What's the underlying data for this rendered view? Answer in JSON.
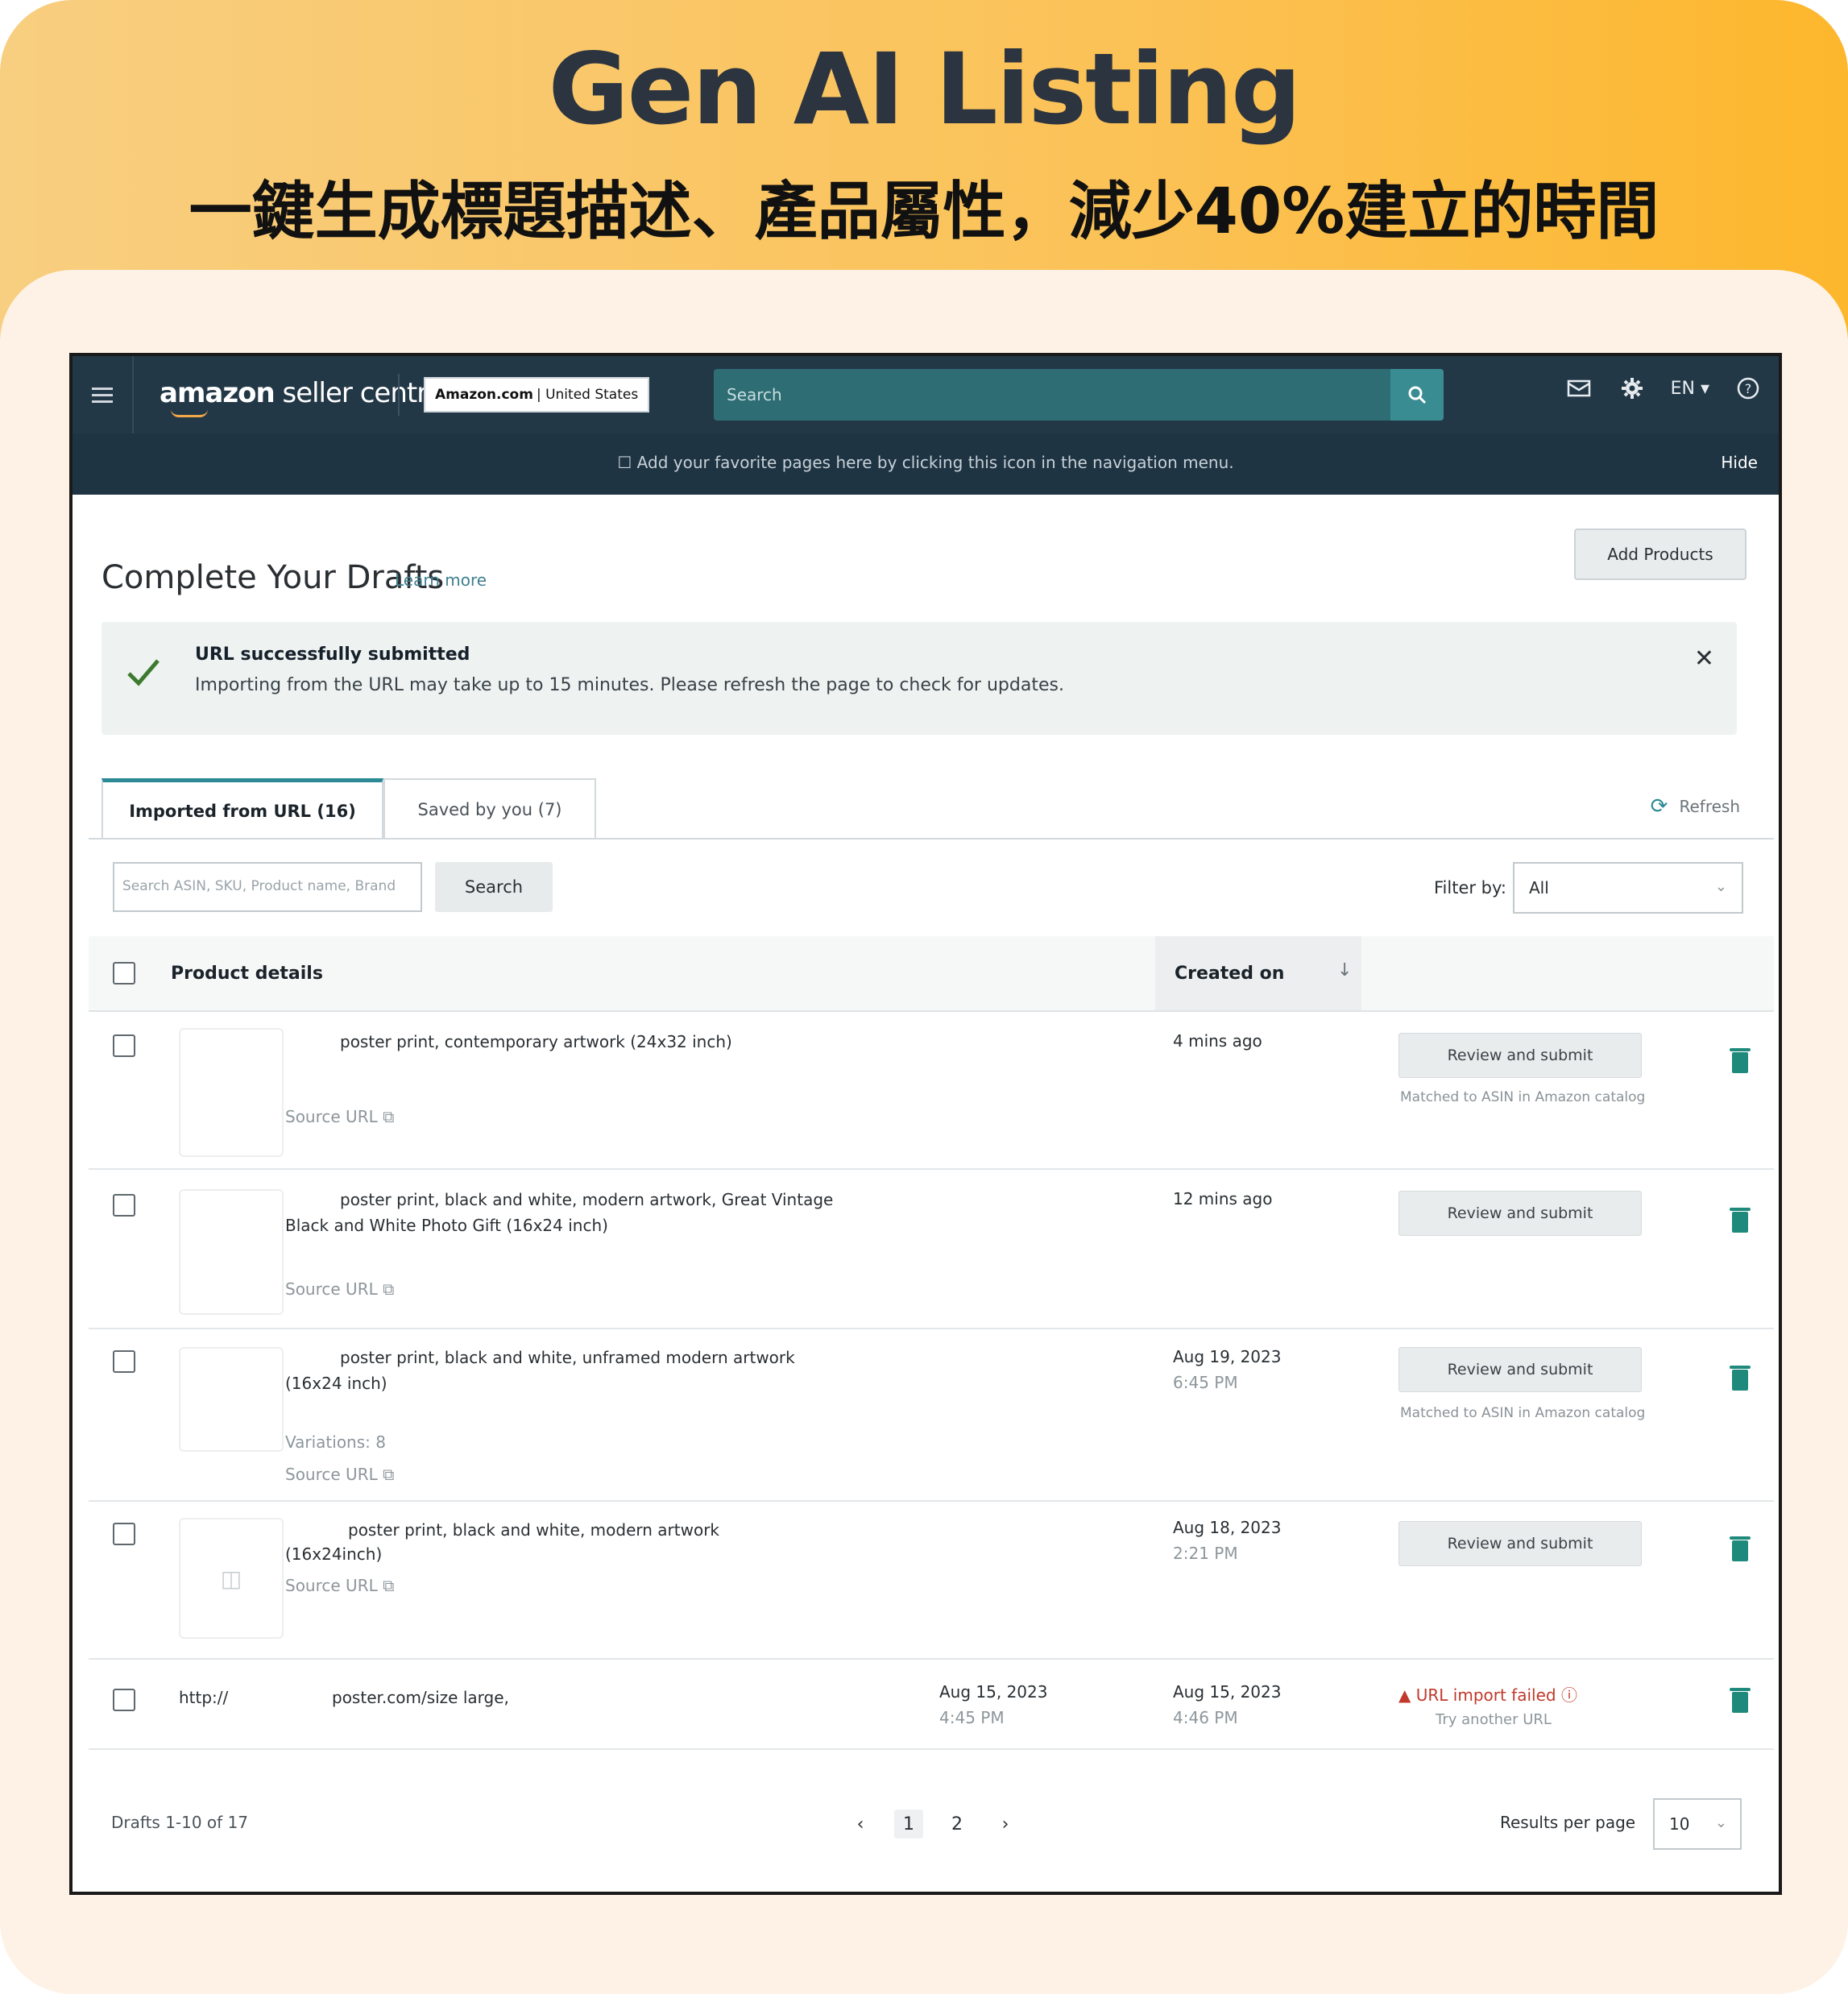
{
  "promo": {
    "headline": "Gen AI Listing",
    "subline": "一鍵生成標題描述、產品屬性，減少40%建立的時間"
  },
  "colors": {
    "banner_start": "#f8ce80",
    "banner_end": "#fdb72d",
    "nav_bg": "#233847",
    "accent_teal": "#2b8a96",
    "danger": "#c0392b"
  },
  "nav": {
    "brand_bold": "amazon",
    "brand_rest": " seller central",
    "marketplace_bold": "Amazon.com",
    "marketplace_rest": "| United States",
    "search_placeholder": "Search",
    "language": "EN ▾",
    "icons": [
      "menu-icon",
      "search-icon",
      "mail-icon",
      "gear-icon",
      "help-icon"
    ]
  },
  "favbar": {
    "message": "☐  Add your favorite pages here by clicking this icon in the navigation menu.",
    "hide": "Hide"
  },
  "page": {
    "title": "Complete Your Drafts",
    "learn_more": "Learn more",
    "add_products": "Add Products"
  },
  "alert": {
    "title": "URL successfully submitted",
    "body": "Importing from the URL may take up to 15 minutes. Please refresh the page to check for updates.",
    "close": "✕"
  },
  "tabs": {
    "active": "Imported from URL (16)",
    "other": "Saved by you (7)",
    "refresh": "Refresh"
  },
  "toolbar": {
    "search_placeholder": "Search ASIN, SKU, Product name, Brand",
    "search_button": "Search",
    "filter_label": "Filter by:",
    "filter_value": "All"
  },
  "table": {
    "col_product": "Product details",
    "col_created": "Created on",
    "review_label": "Review and submit",
    "matched_label": "Matched to ASIN in Amazon catalog",
    "rows": [
      {
        "name_line1": "poster print, contemporary artwork (24x32 inch)",
        "name_line2": "",
        "variations": "",
        "source": "Source URL ⧉",
        "date": "4 mins ago",
        "time": ""
      },
      {
        "name_line1": "poster print, black and white, modern artwork, Great Vintage",
        "name_line2": "Black and White Photo Gift (16x24 inch)",
        "variations": "",
        "source": "Source URL ⧉",
        "date": "12 mins ago",
        "time": ""
      },
      {
        "name_line1": "poster print, black and white, unframed modern artwork",
        "name_line2": "(16x24 inch)",
        "variations": "Variations: 8",
        "source": "Source URL ⧉",
        "date": "Aug 19, 2023",
        "time": "6:45 PM"
      },
      {
        "name_line1": "poster print, black and white, modern artwork",
        "name_line2": "(16x24inch)",
        "variations": "",
        "source": "Source URL ⧉",
        "date": "Aug 18, 2023",
        "time": "2:21 PM"
      },
      {
        "url_part1": "http://",
        "url_part2": "poster.com/size large,",
        "submitted_date": "Aug 15, 2023",
        "submitted_time": "4:45 PM",
        "date": "Aug 15, 2023",
        "time": "4:46 PM",
        "failed": "URL import failed ⓘ",
        "try_another": "Try another URL"
      }
    ]
  },
  "footer": {
    "drafts_count": "Drafts 1-10 of 17",
    "prev": "‹",
    "pages": [
      "1",
      "2"
    ],
    "next": "›",
    "rpp_label": "Results per page",
    "rpp_value": "10"
  }
}
